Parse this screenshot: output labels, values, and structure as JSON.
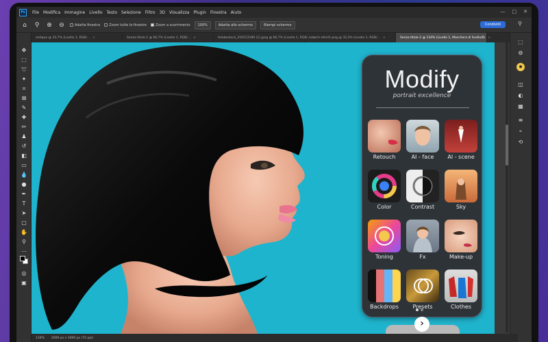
{
  "app": {
    "logo": "Ps"
  },
  "menu": [
    "File",
    "Modifica",
    "Immagine",
    "Livello",
    "Testo",
    "Selezione",
    "Filtro",
    "3D",
    "Visualizza",
    "Plugin",
    "Finestra",
    "Aiuto"
  ],
  "window_controls": [
    "—",
    "□",
    "✕"
  ],
  "options_bar": {
    "checkboxes": [
      "Adatta finestra",
      "Zoom tutte le finestre",
      "Zoom a scorrimento"
    ],
    "buttons": [
      "100%",
      "Adatta allo schermo",
      "Riempi schermo"
    ],
    "share_label": "Condividi"
  },
  "tabs": [
    {
      "label": "antique @ 33,7% (Livello 1, RGB/...",
      "close": "×",
      "active": false
    },
    {
      "label": "Senza titolo-1 @ 66,7% (Livello 1, RGB/...",
      "close": "×",
      "active": false
    },
    {
      "label": "Adobestock_250513189 (1).jpeg @ 66,7% (Livello 1, RGB/...",
      "close": "×",
      "active": false
    },
    {
      "label": "retarch-efect1.png @ 33,3% (Livello 1, RGB/...",
      "close": "×",
      "active": false
    },
    {
      "label": "Senza titolo-2 @ 134% (Livello 1, Maschera di livello/8)",
      "close": "×",
      "active": true
    }
  ],
  "status_bar": {
    "zoom": "134%",
    "info": "2000 px x 1600 px (72 ppi)"
  },
  "colors": {
    "canvas_bg": "#1fb4cd",
    "panel_bg": "#2e3338",
    "accent": "#2d6bd8"
  },
  "plugin": {
    "title": "Modify",
    "subtitle": "portrait excellence",
    "items": [
      {
        "label": "Retouch",
        "icon": "retouch-icon"
      },
      {
        "label": "AI - face",
        "icon": "ai-face-icon"
      },
      {
        "label": "AI - scene",
        "icon": "ai-scene-icon"
      },
      {
        "label": "Color",
        "icon": "color-icon"
      },
      {
        "label": "Contrast",
        "icon": "contrast-icon"
      },
      {
        "label": "Sky",
        "icon": "sky-icon"
      },
      {
        "label": "Toning",
        "icon": "toning-icon"
      },
      {
        "label": "Fx",
        "icon": "fx-icon"
      },
      {
        "label": "Make-up",
        "icon": "makeup-icon"
      },
      {
        "label": "Backdrops",
        "icon": "backdrops-icon"
      },
      {
        "label": "Presets",
        "icon": "presets-icon"
      },
      {
        "label": "Clothes",
        "icon": "clothes-icon"
      }
    ],
    "next_glyph": "›"
  }
}
